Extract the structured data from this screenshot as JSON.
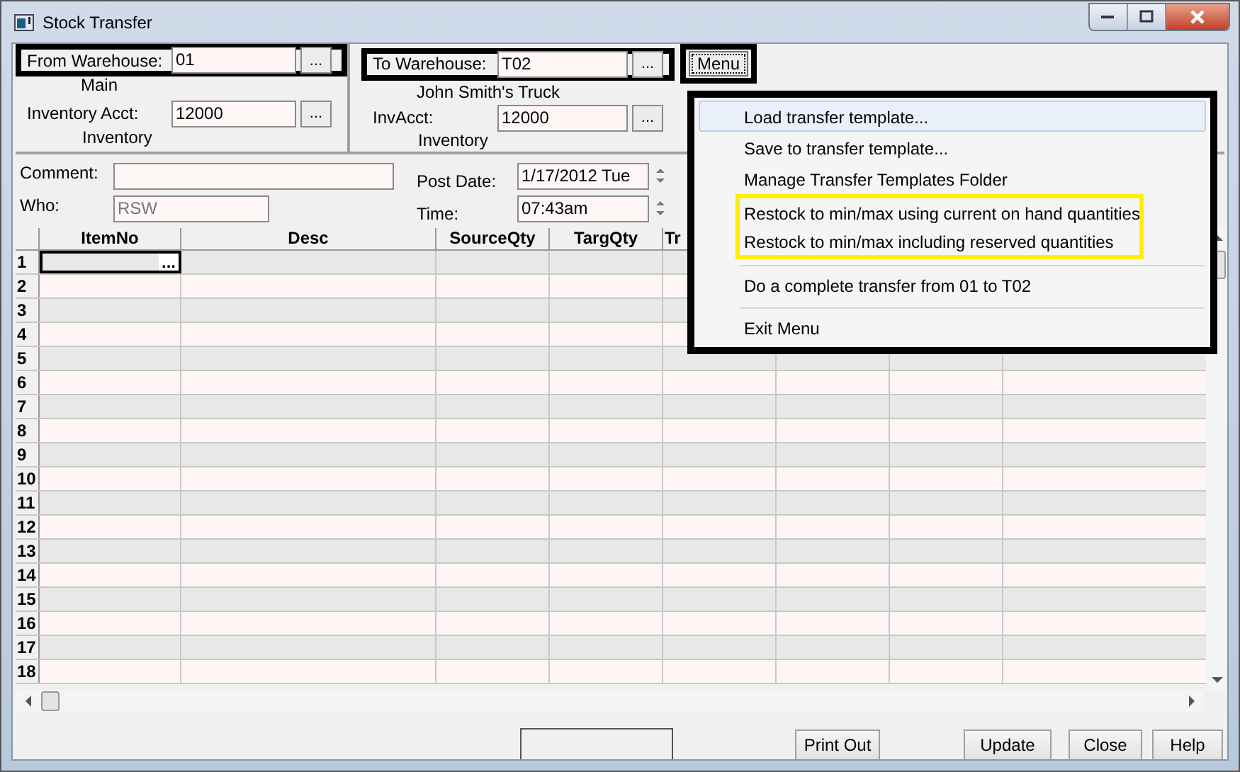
{
  "window": {
    "title": "Stock Transfer"
  },
  "from": {
    "label": "From Warehouse:",
    "value": "01",
    "name": "Main",
    "acct_label": "Inventory Acct:",
    "acct_value": "12000",
    "acct_name": "Inventory",
    "outlined": true
  },
  "to": {
    "label": "To Warehouse:",
    "value": "T02",
    "name": "John Smith's Truck",
    "acct_label": "InvAcct:",
    "acct_value": "12000",
    "acct_name": "Inventory",
    "outlined": true
  },
  "browse_button": "...",
  "menu_button": {
    "label": "Menu",
    "outlined": true
  },
  "comment": {
    "label": "Comment:"
  },
  "who": {
    "label": "Who:",
    "value": "RSW",
    "disabled": true
  },
  "post_date": {
    "label": "Post Date:",
    "value": "1/17/2012 Tue"
  },
  "time": {
    "label": "Time:",
    "value": "07:43am"
  },
  "grid": {
    "columns": [
      "ItemNo",
      "Desc",
      "SourceQty",
      "TargQty",
      "Tr"
    ],
    "cell_button": "...",
    "rows": [
      {
        "number": "1",
        "selected": true
      },
      {
        "number": "2",
        "selected": false
      },
      {
        "number": "3",
        "selected": false
      },
      {
        "number": "4",
        "selected": false
      },
      {
        "number": "5",
        "selected": false
      },
      {
        "number": "6",
        "selected": false
      },
      {
        "number": "7",
        "selected": false
      },
      {
        "number": "8",
        "selected": false
      },
      {
        "number": "9",
        "selected": false
      },
      {
        "number": "10",
        "selected": false
      },
      {
        "number": "11",
        "selected": false
      },
      {
        "number": "12",
        "selected": false
      },
      {
        "number": "13",
        "selected": false
      },
      {
        "number": "14",
        "selected": false
      },
      {
        "number": "15",
        "selected": false
      },
      {
        "number": "16",
        "selected": false
      },
      {
        "number": "17",
        "selected": false
      },
      {
        "number": "18",
        "selected": false
      }
    ]
  },
  "menu": {
    "outlined": true,
    "items": [
      {
        "label": "Load transfer template...",
        "selected": true,
        "highlighted": false,
        "separator_before": false
      },
      {
        "label": "Save to transfer template...",
        "selected": false,
        "highlighted": false,
        "separator_before": false
      },
      {
        "label": "Manage Transfer Templates Folder",
        "selected": false,
        "highlighted": false,
        "separator_before": false
      },
      {
        "label": "Restock to min/max using current on hand quantities",
        "selected": false,
        "highlighted": true,
        "separator_before": false
      },
      {
        "label": "Restock to min/max including reserved quantities",
        "selected": false,
        "highlighted": true,
        "separator_before": false
      },
      {
        "label": "Do a complete transfer from 01 to T02",
        "selected": false,
        "highlighted": false,
        "separator_before": true
      },
      {
        "label": "Exit Menu",
        "selected": false,
        "highlighted": false,
        "separator_before": true
      }
    ]
  },
  "buttons": {
    "print": "Print Out",
    "update": "Update",
    "close": "Close",
    "help": "Help"
  }
}
